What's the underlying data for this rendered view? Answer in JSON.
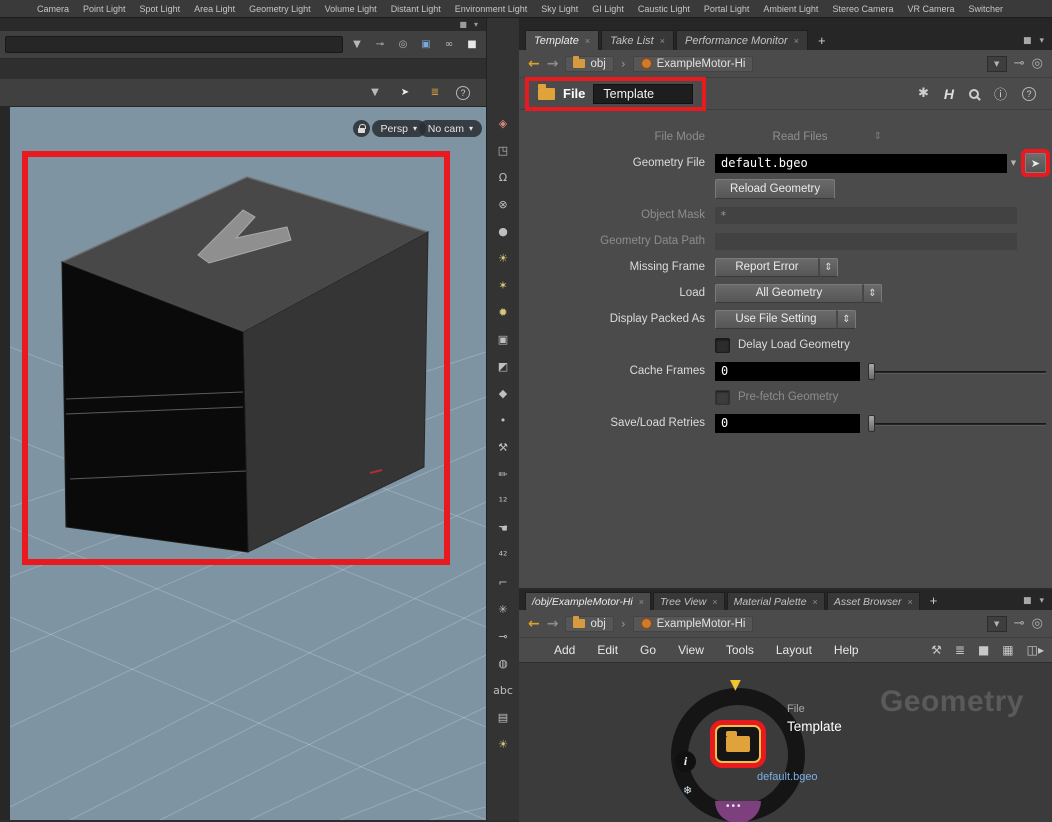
{
  "glyphs": {
    "close": "×",
    "caret": "▾",
    "dropdown": "▼",
    "updown": "⇕",
    "back": "←",
    "forward": "→",
    "crumb_sep": "›",
    "pin": "⊸",
    "radial": "◎",
    "square": "■",
    "asterisk_gear": "✱",
    "houdini_logo": "H",
    "info_circle": "ⓘ",
    "help": "?",
    "chooser_cursor": "➤",
    "cursor": "➤",
    "box_blue": "▣",
    "glasses": "∞",
    "list_orange": "≣",
    "node_arrow_down": "▼",
    "node_dots": "•••",
    "snowflake": "❄"
  },
  "colors": {
    "annotation": "#e8191f",
    "accent_orange": "#e0a33c",
    "link_blue": "#7ab0e8",
    "viewport_bg": "#7e94a3"
  },
  "shelf": {
    "items": [
      "Camera",
      "Point Light",
      "Spot Light",
      "Area Light",
      "Geometry Light",
      "Volume Light",
      "Distant Light",
      "Environment Light",
      "Sky Light",
      "GI Light",
      "Caustic Light",
      "Portal Light",
      "Ambient Light",
      "Stereo Camera",
      "VR Camera",
      "Switcher"
    ]
  },
  "viewport": {
    "persp": "Persp",
    "no_cam": "No cam"
  },
  "breadcrumb": {
    "root": "obj",
    "node": "ExampleMotor-Hi"
  },
  "side_strip": {
    "icons": [
      {
        "name": "import-icon",
        "glyph": "◈"
      },
      {
        "name": "export-icon",
        "glyph": "◳"
      },
      {
        "name": "lock-icon",
        "glyph": "Ω"
      },
      {
        "name": "visibility-off-icon",
        "glyph": "⊗"
      },
      {
        "name": "dark-sphere-icon",
        "glyph": "●"
      },
      {
        "name": "headlight-icon",
        "glyph": "☀"
      },
      {
        "name": "point-light-icon",
        "glyph": "✶"
      },
      {
        "name": "spot-light-icon",
        "glyph": "✹"
      },
      {
        "name": "camera-view-icon",
        "glyph": "▣"
      },
      {
        "name": "shadow-icon",
        "glyph": "◩"
      },
      {
        "name": "material-shader-icon",
        "glyph": "◆"
      },
      {
        "name": "dot-icon",
        "glyph": "•"
      },
      {
        "name": "hammer-icon",
        "glyph": "⚒"
      },
      {
        "name": "pencil-icon",
        "glyph": "✏"
      },
      {
        "name": "point-numbers-icon",
        "glyph": "¹²"
      },
      {
        "name": "hand-icon",
        "glyph": "☚"
      },
      {
        "name": "prim-numbers-icon",
        "glyph": "⁴²"
      },
      {
        "name": "ruler-icon",
        "glyph": "⌐"
      },
      {
        "name": "asterisk-icon",
        "glyph": "✳"
      },
      {
        "name": "pin-icon",
        "glyph": "⊸"
      },
      {
        "name": "pause-icon",
        "glyph": "◍"
      },
      {
        "name": "abc-icon",
        "glyph": "abc"
      },
      {
        "name": "image-plane-icon",
        "glyph": "▤"
      },
      {
        "name": "light-bulb-icon",
        "glyph": "☀"
      }
    ]
  },
  "top_panel": {
    "tabs": [
      "Template",
      "Take List",
      "Performance Monitor"
    ],
    "add_tab": "+",
    "header": {
      "type_label": "File",
      "name": "Template"
    },
    "params": {
      "file_mode": {
        "label": "File Mode",
        "value": "Read Files"
      },
      "geometry_file": {
        "label": "Geometry File",
        "value": "default.bgeo"
      },
      "reload": {
        "button": "Reload Geometry"
      },
      "object_mask": {
        "label": "Object Mask",
        "value": "*"
      },
      "geometry_data_path": {
        "label": "Geometry Data Path",
        "value": ""
      },
      "missing_frame": {
        "label": "Missing Frame",
        "value": "Report Error"
      },
      "load": {
        "label": "Load",
        "value": "All Geometry"
      },
      "display_packed_as": {
        "label": "Display Packed As",
        "value": "Use File Setting"
      },
      "delay_load": {
        "label": "Delay Load Geometry"
      },
      "cache_frames": {
        "label": "Cache Frames",
        "value": "0"
      },
      "prefetch": {
        "label": "Pre-fetch Geometry"
      },
      "save_load_retries": {
        "label": "Save/Load Retries",
        "value": "0"
      }
    }
  },
  "bottom_panel": {
    "tabs": [
      "/obj/ExampleMotor-Hi",
      "Tree View",
      "Material Palette",
      "Asset Browser"
    ],
    "add_tab": "+",
    "menus": [
      "Add",
      "Edit",
      "Go",
      "View",
      "Tools",
      "Layout",
      "Help"
    ],
    "toolbar_icons": [
      {
        "name": "wrench-icon",
        "glyph": "⚒"
      },
      {
        "name": "list-icon",
        "glyph": "≣"
      },
      {
        "name": "fill-icon",
        "glyph": "■"
      },
      {
        "name": "grid-icon",
        "glyph": "▦"
      },
      {
        "name": "panel-toggle-icon",
        "glyph": "◫▸"
      }
    ],
    "watermark": "Geometry",
    "node": {
      "info": "i",
      "type_label": "File",
      "name": "Template",
      "file": "default.bgeo"
    }
  }
}
